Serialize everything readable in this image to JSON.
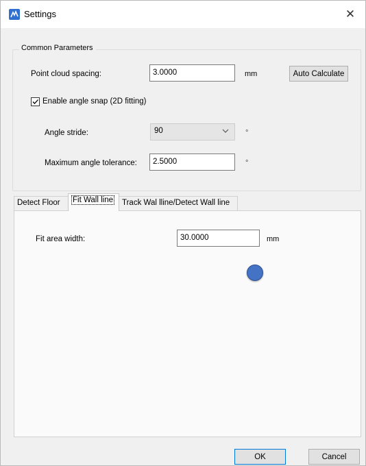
{
  "window": {
    "title": "Settings",
    "icon": "app-logo-icon",
    "close_glyph": "✕"
  },
  "common": {
    "group_title": "Common Parameters",
    "point_cloud_spacing": {
      "label": "Point cloud spacing:",
      "value": "3.0000",
      "unit": "mm"
    },
    "auto_calculate_label": "Auto Calculate",
    "angle_snap": {
      "label": "Enable angle snap (2D fitting)",
      "checked": true
    },
    "angle_stride": {
      "label": "Angle stride:",
      "value": "90",
      "unit": "°"
    },
    "max_angle_tolerance": {
      "label": "Maximum angle tolerance:",
      "value": "2.5000",
      "unit": "°"
    }
  },
  "tabs": [
    {
      "label": "Detect Floor",
      "active": false
    },
    {
      "label": "Fit Wall line",
      "active": true
    },
    {
      "label": "Track Wal lline/Detect Wall line",
      "active": false
    }
  ],
  "fit_wall": {
    "fit_area_width": {
      "label": "Fit area width:",
      "value": "30.0000",
      "unit": "mm"
    }
  },
  "footer": {
    "ok": {
      "mnemonic": "O",
      "rest": "K"
    },
    "cancel": {
      "mnemonic": "C",
      "rest": "ancel"
    }
  },
  "colors": {
    "accent": "#0078d7",
    "cursor": "#4472c4"
  }
}
